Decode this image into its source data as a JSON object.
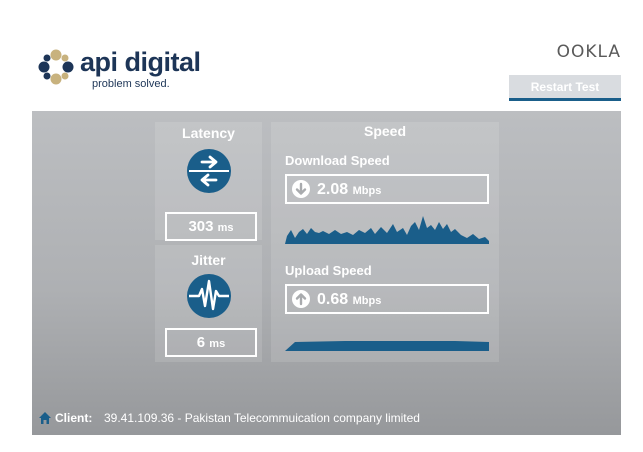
{
  "brand": {
    "name": "api digital",
    "tagline": "problem solved.",
    "partner": "OOKLA"
  },
  "toolbar": {
    "restart_label": "Restart Test"
  },
  "latency": {
    "title": "Latency",
    "value": "303",
    "unit": "ms"
  },
  "jitter": {
    "title": "Jitter",
    "value": "6",
    "unit": "ms"
  },
  "speed": {
    "title": "Speed",
    "download": {
      "label": "Download Speed",
      "value": "2.08",
      "unit": "Mbps"
    },
    "upload": {
      "label": "Upload Speed",
      "value": "0.68",
      "unit": "Mbps"
    }
  },
  "client": {
    "label": "Client:",
    "value": "39.41.109.36 - Pakistan Telecommuication company limited"
  },
  "colors": {
    "accent": "#1a5e8a",
    "stage": "#b5b7ba",
    "text_light": "#ffffff"
  }
}
